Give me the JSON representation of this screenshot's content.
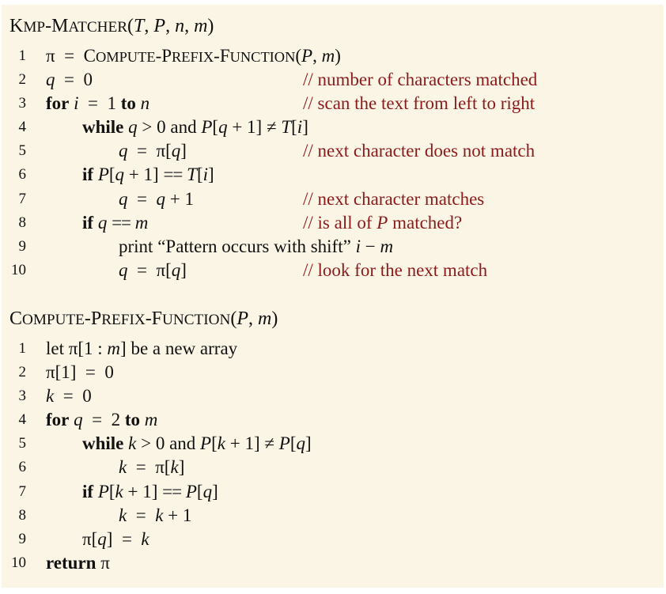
{
  "kmp_matcher": {
    "name": "KMP-Matcher",
    "params": "(T, P, n, m)",
    "lines": [
      {
        "n": "1",
        "indent": 0,
        "code": "π = Compute-Prefix-Function(P, m)",
        "comment": ""
      },
      {
        "n": "2",
        "indent": 0,
        "code": "q = 0",
        "comment": "// number of characters matched"
      },
      {
        "n": "3",
        "indent": 0,
        "code": "for i = 1 to n",
        "comment": "// scan the text from left to right"
      },
      {
        "n": "4",
        "indent": 1,
        "code": "while q > 0 and P[q + 1] ≠ T[i]",
        "comment": ""
      },
      {
        "n": "5",
        "indent": 2,
        "code": "q = π[q]",
        "comment": "// next character does not match"
      },
      {
        "n": "6",
        "indent": 1,
        "code": "if P[q + 1] == T[i]",
        "comment": ""
      },
      {
        "n": "7",
        "indent": 2,
        "code": "q = q + 1",
        "comment": "// next character matches"
      },
      {
        "n": "8",
        "indent": 1,
        "code": "if q == m",
        "comment": "// is all of P matched?"
      },
      {
        "n": "9",
        "indent": 2,
        "code": "print “Pattern occurs with shift” i − m",
        "comment": ""
      },
      {
        "n": "10",
        "indent": 2,
        "code": "q = π[q]",
        "comment": "// look for the next match"
      }
    ]
  },
  "compute_prefix_function": {
    "name": "Compute-Prefix-Function",
    "params": "(P, m)",
    "lines": [
      {
        "n": "1",
        "indent": 0,
        "code": "let π[1 : m] be a new array",
        "comment": ""
      },
      {
        "n": "2",
        "indent": 0,
        "code": "π[1] = 0",
        "comment": ""
      },
      {
        "n": "3",
        "indent": 0,
        "code": "k = 0",
        "comment": ""
      },
      {
        "n": "4",
        "indent": 0,
        "code": "for q = 2 to m",
        "comment": ""
      },
      {
        "n": "5",
        "indent": 1,
        "code": "while k > 0 and P[k + 1] ≠ P[q]",
        "comment": ""
      },
      {
        "n": "6",
        "indent": 2,
        "code": "k = π[k]",
        "comment": ""
      },
      {
        "n": "7",
        "indent": 1,
        "code": "if P[k + 1] == P[q]",
        "comment": ""
      },
      {
        "n": "8",
        "indent": 2,
        "code": "k = k + 1",
        "comment": ""
      },
      {
        "n": "9",
        "indent": 1,
        "code": "π[q] = k",
        "comment": ""
      },
      {
        "n": "10",
        "indent": 0,
        "code": "return π",
        "comment": ""
      }
    ]
  },
  "colors": {
    "background": "#fbf5e6",
    "comment": "#8b1a1a",
    "text": "#111111"
  }
}
